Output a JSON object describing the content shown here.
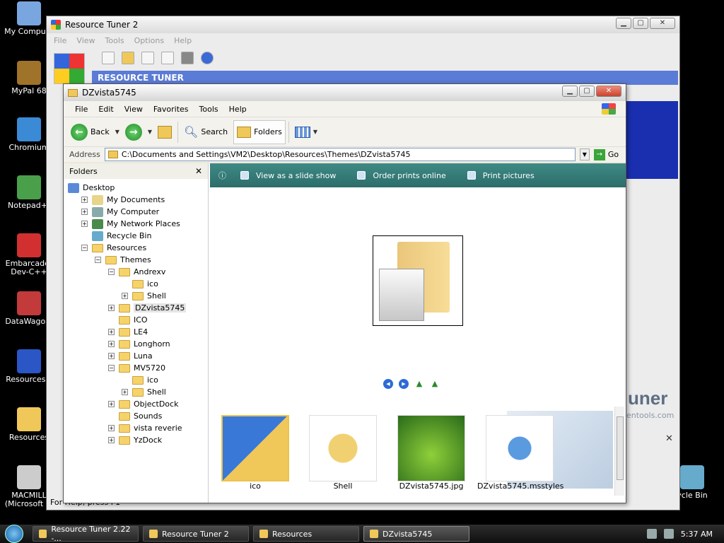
{
  "desktop_icons": [
    {
      "id": "my-computer",
      "label": "My Compute"
    },
    {
      "id": "mypal",
      "label": "MyPal 68"
    },
    {
      "id": "chromium",
      "label": "Chromium"
    },
    {
      "id": "notepad",
      "label": "Notepad+-"
    },
    {
      "id": "embarcadero",
      "label": "Embarcader Dev-C++"
    },
    {
      "id": "datawagon",
      "label": "DataWagon."
    },
    {
      "id": "resources-zip",
      "label": "Resources.z"
    },
    {
      "id": "resources",
      "label": "Resources"
    },
    {
      "id": "macmill",
      "label": "MACMILL (Microsoft E."
    },
    {
      "id": "recycle-bin",
      "label": "ycle Bin"
    }
  ],
  "resource_tuner": {
    "title": "Resource Tuner 2",
    "menu": [
      "File",
      "View",
      "Tools",
      "Options",
      "Help"
    ],
    "banner": "RESOURCE TUNER",
    "logo_text": "uner",
    "logo_sub": "entools.com",
    "status": "For Help, press F1"
  },
  "explorer": {
    "title": "DZvista5745",
    "menu": [
      "File",
      "Edit",
      "View",
      "Favorites",
      "Tools",
      "Help"
    ],
    "toolbar": {
      "back": "Back",
      "search": "Search",
      "folders": "Folders"
    },
    "address_label": "Address",
    "address_value": "C:\\Documents and Settings\\VM2\\Desktop\\Resources\\Themes\\DZvista5745",
    "go_label": "Go",
    "folders_header": "Folders",
    "tree": [
      {
        "label": "Desktop",
        "indent": 0,
        "exp": "",
        "icon": "desktop"
      },
      {
        "label": "My Documents",
        "indent": 1,
        "exp": "+",
        "icon": "docs"
      },
      {
        "label": "My Computer",
        "indent": 1,
        "exp": "+",
        "icon": "computer"
      },
      {
        "label": "My Network Places",
        "indent": 1,
        "exp": "+",
        "icon": "network"
      },
      {
        "label": "Recycle Bin",
        "indent": 1,
        "exp": "",
        "icon": "recycle"
      },
      {
        "label": "Resources",
        "indent": 1,
        "exp": "-",
        "icon": "folder"
      },
      {
        "label": "Themes",
        "indent": 2,
        "exp": "-",
        "icon": "folder"
      },
      {
        "label": "Andrexv",
        "indent": 3,
        "exp": "-",
        "icon": "folder"
      },
      {
        "label": "ico",
        "indent": 4,
        "exp": "",
        "icon": "folder"
      },
      {
        "label": "Shell",
        "indent": 4,
        "exp": "+",
        "icon": "folder"
      },
      {
        "label": "DZvista5745",
        "indent": 3,
        "exp": "+",
        "icon": "folder"
      },
      {
        "label": "ICO",
        "indent": 3,
        "exp": "",
        "icon": "folder"
      },
      {
        "label": "LE4",
        "indent": 3,
        "exp": "+",
        "icon": "folder"
      },
      {
        "label": "Longhorn",
        "indent": 3,
        "exp": "+",
        "icon": "folder"
      },
      {
        "label": "Luna",
        "indent": 3,
        "exp": "+",
        "icon": "folder"
      },
      {
        "label": "MV5720",
        "indent": 3,
        "exp": "-",
        "icon": "folder"
      },
      {
        "label": "ico",
        "indent": 4,
        "exp": "",
        "icon": "folder"
      },
      {
        "label": "Shell",
        "indent": 4,
        "exp": "+",
        "icon": "folder"
      },
      {
        "label": "ObjectDock",
        "indent": 3,
        "exp": "+",
        "icon": "folder"
      },
      {
        "label": "Sounds",
        "indent": 3,
        "exp": "",
        "icon": "folder"
      },
      {
        "label": "vista reverie",
        "indent": 3,
        "exp": "+",
        "icon": "folder"
      },
      {
        "label": "YzDock",
        "indent": 3,
        "exp": "+",
        "icon": "folder"
      }
    ],
    "tasks": [
      "View as a slide show",
      "Order prints online",
      "Print pictures"
    ],
    "thumbnails": [
      {
        "label": "ico",
        "selected": true
      },
      {
        "label": "Shell",
        "selected": false
      },
      {
        "label": "DZvista5745.jpg",
        "selected": false
      },
      {
        "label": "DZvista5745.msstyles",
        "selected": false
      }
    ]
  },
  "taskbar": {
    "tasks": [
      {
        "label": "Resource Tuner 2.22 -...",
        "active": false
      },
      {
        "label": "Resource Tuner 2",
        "active": false
      },
      {
        "label": "Resources",
        "active": false
      },
      {
        "label": "DZvista5745",
        "active": true
      }
    ],
    "clock": "5:37 AM"
  }
}
